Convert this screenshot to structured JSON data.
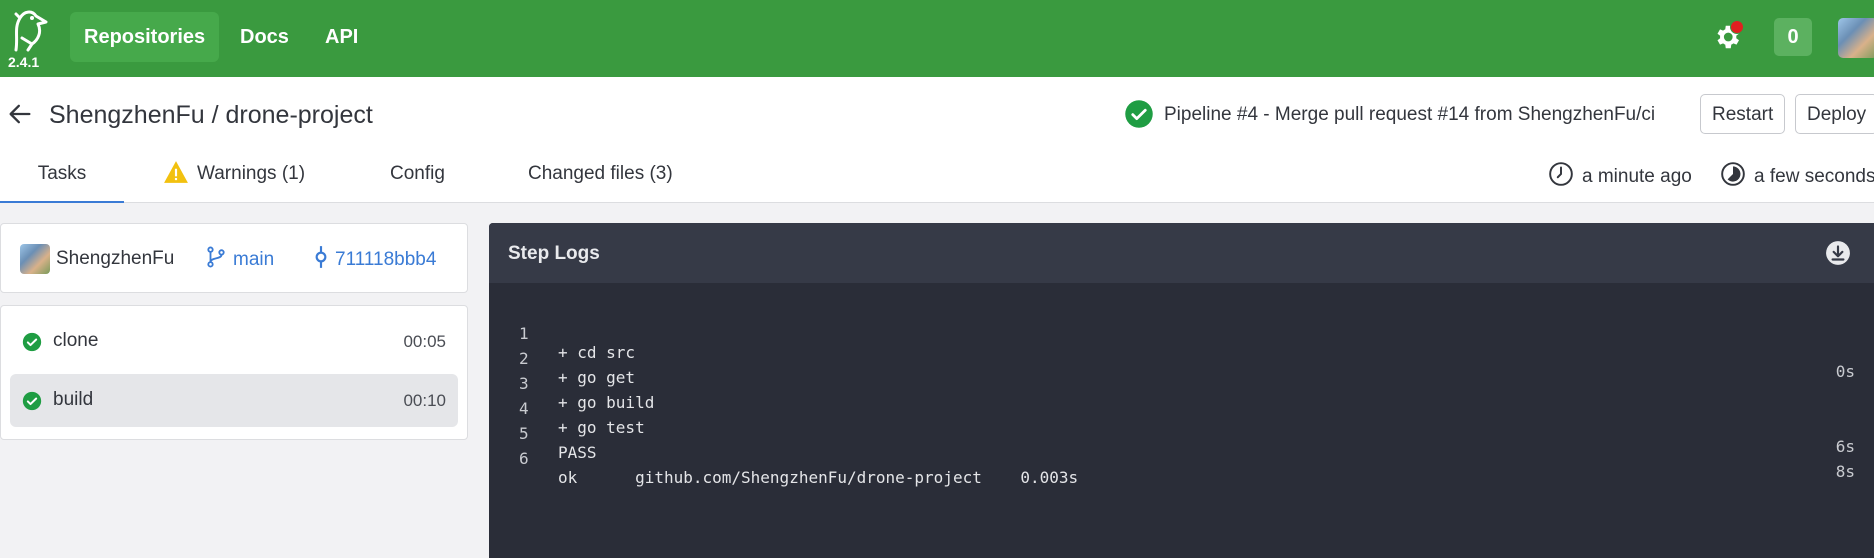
{
  "app": {
    "version": "2.4.1",
    "nav": [
      {
        "label": "Repositories",
        "active": true
      },
      {
        "label": "Docs",
        "active": false
      },
      {
        "label": "API",
        "active": false
      }
    ],
    "notification_count": "0",
    "brand_color": "#3a9a3f",
    "link_color": "#3a7bd5",
    "success_color": "#1f9d43"
  },
  "header": {
    "repo_title": "ShengzhenFu / drone-project",
    "pipeline_text": "Pipeline #4  -  Merge pull request #14 from ShengzhenFu/ci",
    "restart_label": "Restart",
    "deploy_label": "Deploy",
    "tabs": [
      {
        "label": "Tasks",
        "active": true
      },
      {
        "label": "Warnings (1)",
        "active": false,
        "icon": "warning-icon"
      },
      {
        "label": "Config",
        "active": false
      },
      {
        "label": "Changed files (3)",
        "active": false
      }
    ],
    "created": "a minute ago",
    "duration": "a few seconds"
  },
  "commit_info": {
    "author": "ShengzhenFu",
    "branch": "main",
    "commit": "711118bbb4"
  },
  "steps": [
    {
      "name": "clone",
      "duration": "00:05",
      "status": "success",
      "selected": false
    },
    {
      "name": "build",
      "duration": "00:10",
      "status": "success",
      "selected": true
    }
  ],
  "logs": {
    "title": "Step Logs",
    "lines": [
      {
        "n": "1",
        "text": "+ cd src",
        "time": "0s"
      },
      {
        "n": "2",
        "text": "+ go get",
        "time": ""
      },
      {
        "n": "3",
        "text": "+ go build",
        "time": ""
      },
      {
        "n": "4",
        "text": "+ go test",
        "time": "6s"
      },
      {
        "n": "5",
        "text": "PASS",
        "time": "8s"
      },
      {
        "n": "6",
        "text": "ok  \tgithub.com/ShengzhenFu/drone-project\t0.003s",
        "time": ""
      }
    ]
  }
}
